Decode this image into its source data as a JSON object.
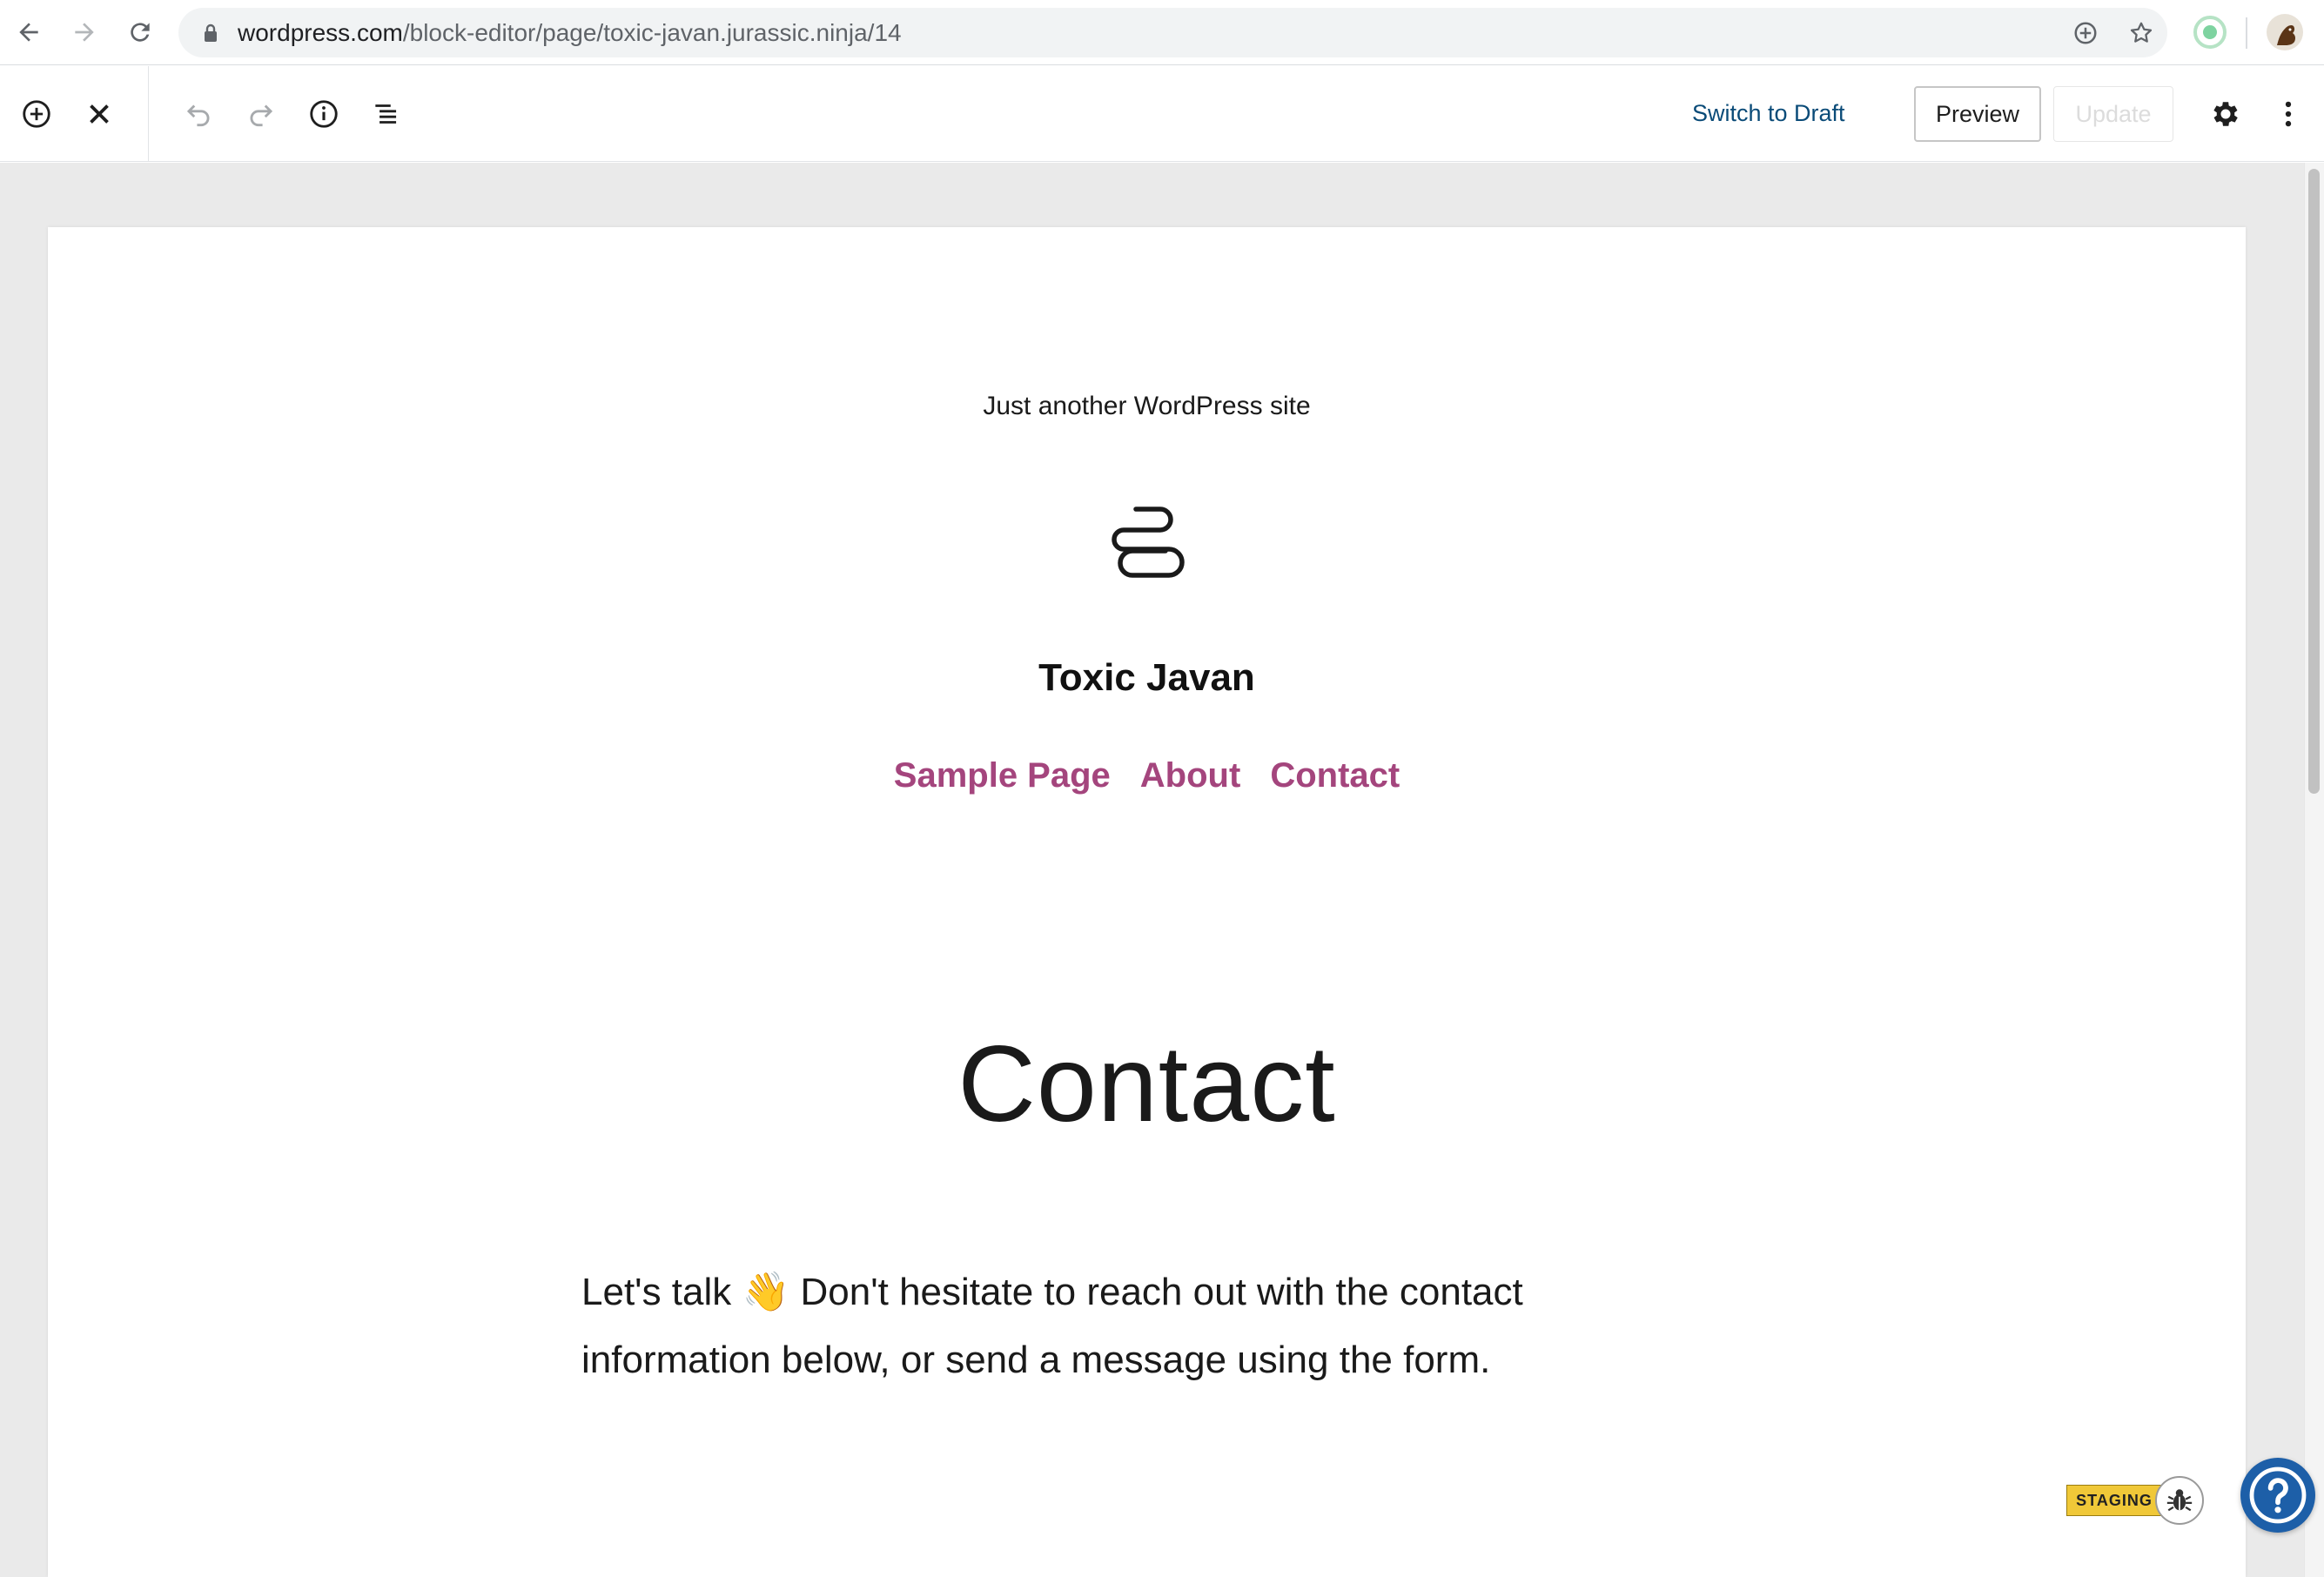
{
  "browser": {
    "url_host": "wordpress.com",
    "url_path": "/block-editor/page/toxic-javan.jurassic.ninja/14"
  },
  "toolbar": {
    "switch_to_draft_label": "Switch to Draft",
    "preview_label": "Preview",
    "update_label": "Update"
  },
  "site": {
    "tagline": "Just another WordPress site",
    "title": "Toxic Javan",
    "nav": [
      "Sample Page",
      "About",
      "Contact"
    ]
  },
  "page": {
    "title": "Contact",
    "intro_before_emoji": "Let's talk ",
    "emoji": "👋",
    "intro_after_emoji": " Don't hesitate to reach out with the contact information below, or send a message using the form."
  },
  "badges": {
    "staging_label": "STAGING"
  },
  "colors": {
    "nav_link": "#a4457d",
    "link_blue": "#0a4b78",
    "help_button": "#1d5fa8",
    "staging": "#f0c838"
  }
}
